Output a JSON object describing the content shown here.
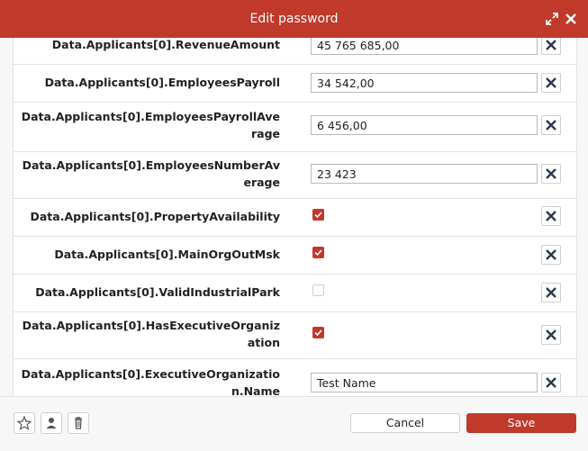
{
  "dialog": {
    "title": "Edit password",
    "accent_color": "#c0392b"
  },
  "fields": [
    {
      "label": "Data.Applicants[0].RevenueAmount",
      "type": "text",
      "value": "45 765 685,00"
    },
    {
      "label": "Data.Applicants[0].EmployeesPayroll",
      "type": "text",
      "value": "34 542,00"
    },
    {
      "label": "Data.Applicants[0].EmployeesPayrollAverage",
      "type": "text",
      "value": "6 456,00"
    },
    {
      "label": "Data.Applicants[0].EmployeesNumberAverage",
      "type": "text",
      "value": "23 423"
    },
    {
      "label": "Data.Applicants[0].PropertyAvailability",
      "type": "checkbox",
      "checked": true
    },
    {
      "label": "Data.Applicants[0].MainOrgOutMsk",
      "type": "checkbox",
      "checked": true
    },
    {
      "label": "Data.Applicants[0].ValidIndustrialPark",
      "type": "checkbox",
      "checked": false
    },
    {
      "label": "Data.Applicants[0].HasExecutiveOrganization",
      "type": "checkbox",
      "checked": true
    },
    {
      "label": "Data.Applicants[0].ExecutiveOrganization.Name",
      "type": "text",
      "value": "Test Name"
    }
  ],
  "footer": {
    "tools": [
      "star-icon",
      "user-icon",
      "trash-icon"
    ],
    "cancel_label": "Cancel",
    "save_label": "Save"
  }
}
